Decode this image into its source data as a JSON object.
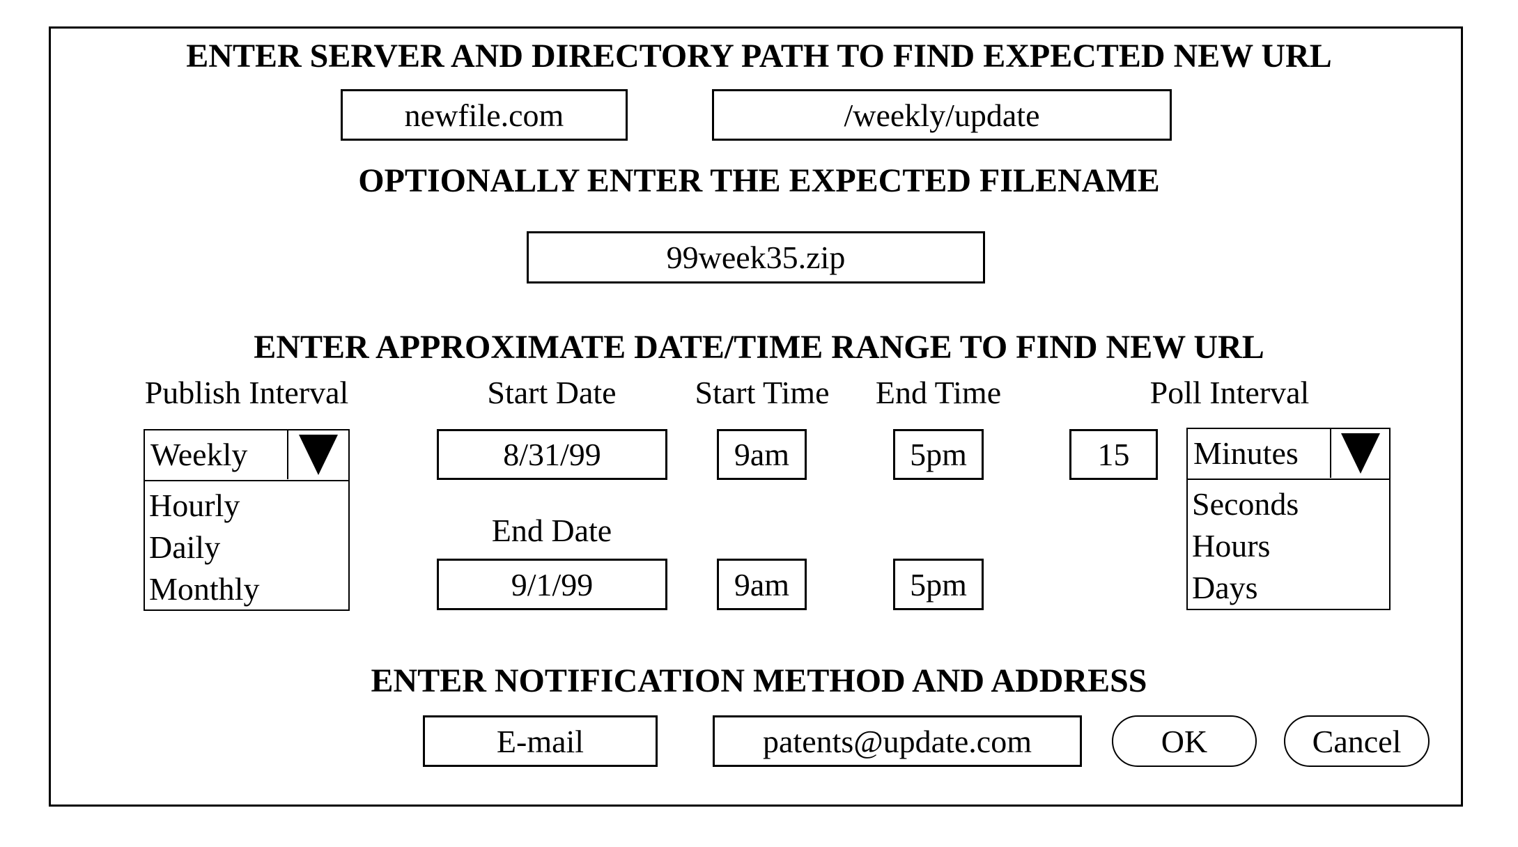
{
  "sections": {
    "server_path_title": "ENTER SERVER AND DIRECTORY PATH TO FIND EXPECTED NEW URL",
    "filename_title": "OPTIONALLY ENTER THE EXPECTED FILENAME",
    "date_range_title": "ENTER APPROXIMATE DATE/TIME RANGE TO FIND NEW URL",
    "notification_title": "ENTER NOTIFICATION METHOD AND ADDRESS"
  },
  "server": {
    "value": "newfile.com"
  },
  "directory": {
    "value": "/weekly/update"
  },
  "filename": {
    "value": "99week35.zip"
  },
  "labels": {
    "publish_interval": "Publish Interval",
    "start_date": "Start Date",
    "start_time": "Start Time",
    "end_time": "End Time",
    "poll_interval": "Poll Interval",
    "end_date": "End Date"
  },
  "publish_interval": {
    "selected": "Weekly",
    "options": [
      "Hourly",
      "Daily",
      "Monthly"
    ]
  },
  "start_date": "8/31/99",
  "start_time_start": "9am",
  "end_time_start": "5pm",
  "end_date": "9/1/99",
  "start_time_end": "9am",
  "end_time_end": "5pm",
  "poll_interval": {
    "value": "15",
    "unit_selected": "Minutes",
    "unit_options": [
      "Seconds",
      "Hours",
      "Days"
    ]
  },
  "notification": {
    "method": "E-mail",
    "address": "patents@update.com"
  },
  "buttons": {
    "ok": "OK",
    "cancel": "Cancel"
  },
  "icons": {
    "dropdown_arrow": "triangle-down-icon"
  }
}
